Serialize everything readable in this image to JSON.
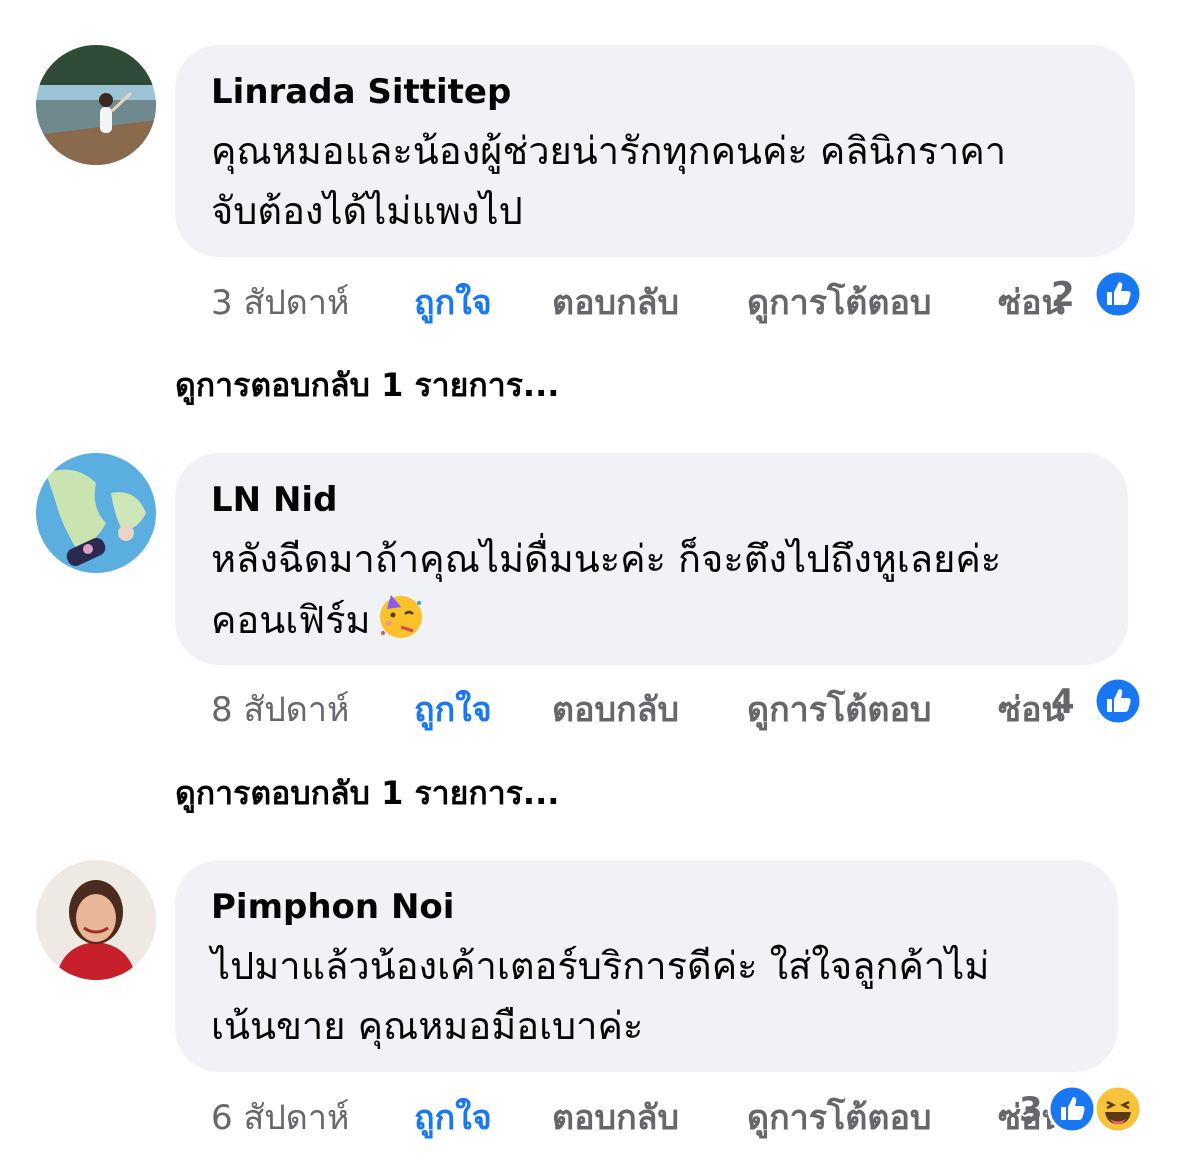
{
  "comments": [
    {
      "author": "Linrada Sittitep",
      "lines": [
        "คุณหมอและน้องผู้ช่วยน่ารักทุกคนค่ะ คลินิกราคา",
        "จับต้องได้ไม่แพงไป"
      ],
      "time": "3 สัปดาห์",
      "like": "ถูกใจ",
      "reply": "ตอบกลับ",
      "edits": "ดูการโต้ตอบ",
      "hide": "ซ่อน",
      "reaction_count": "2",
      "reactions": [
        "like-icon"
      ],
      "view_replies": "ดูการตอบกลับ 1 รายการ..."
    },
    {
      "author": "LN Nid",
      "lines": [
        "หลังฉีดมาถ้าคุณไม่ดื่มนะค่ะ ก็จะตึงไปถึงหูเลยค่ะ",
        "คอนเฟิร์ม"
      ],
      "emoji": "🥳",
      "time": "8 สัปดาห์",
      "like": "ถูกใจ",
      "reply": "ตอบกลับ",
      "edits": "ดูการโต้ตอบ",
      "hide": "ซ่อน",
      "reaction_count": "4",
      "reactions": [
        "like-icon"
      ],
      "view_replies": "ดูการตอบกลับ 1 รายการ..."
    },
    {
      "author": "Pimphon Noi",
      "lines": [
        "ไปมาแล้วน้องเค้าเตอร์บริการดีค่ะ ใส่ใจลูกค้าไม่",
        "เน้นขาย คุณหมอมือเบาค่ะ"
      ],
      "time": "6 สัปดาห์",
      "like": "ถูกใจ",
      "reply": "ตอบกลับ",
      "edits": "ดูการโต้ตอบ",
      "hide": "ซ่อน",
      "reaction_count": "3",
      "reactions": [
        "like-icon",
        "haha-icon"
      ]
    }
  ],
  "colors": {
    "bubble": "#f0f2f5",
    "like_blue": "#1877f2",
    "meta_gray": "#65676b",
    "text": "#050505"
  }
}
